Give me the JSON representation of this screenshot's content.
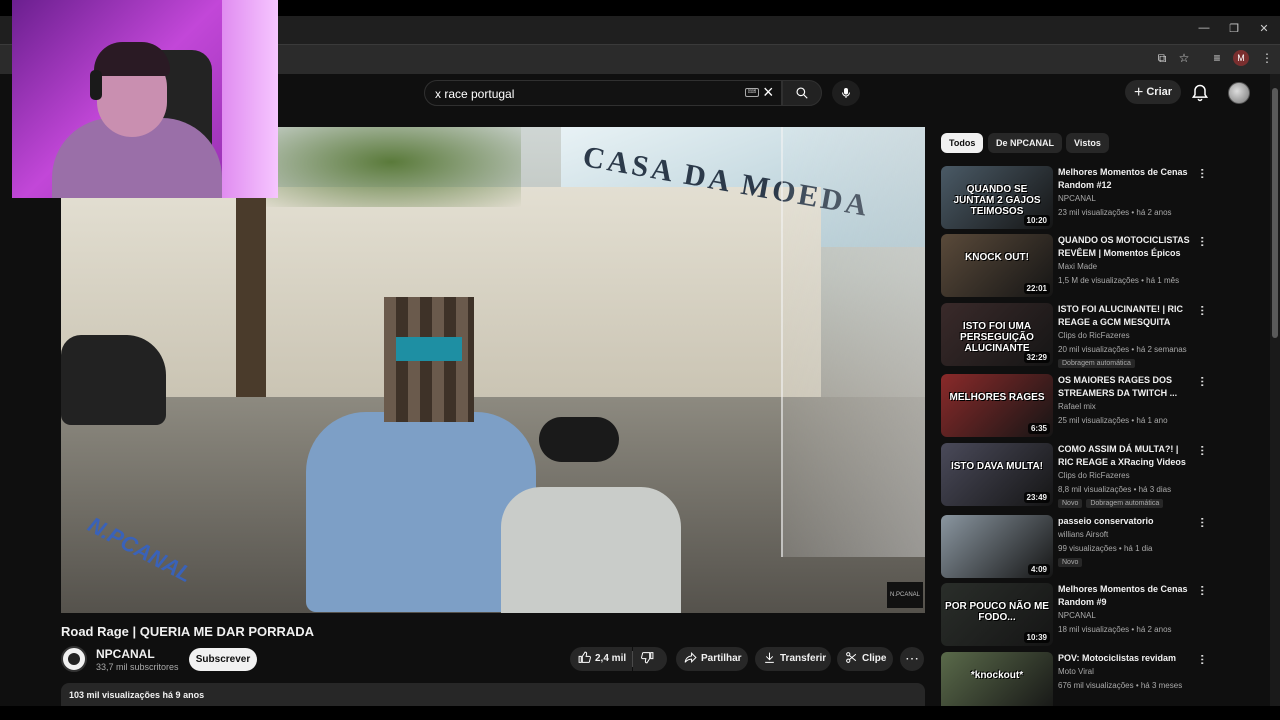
{
  "search": {
    "query": "x race portugal"
  },
  "header": {
    "create_label": "Criar"
  },
  "video": {
    "title": "Road Rage | QUERIA ME DAR PORRADA",
    "watermark": "N.PCANAL",
    "corner_logo": "N.PCANAL",
    "channel": {
      "name": "NPCANAL",
      "subscribers": "33,7 mil subscritores"
    },
    "subscribe_label": "Subscrever",
    "likes": "2,4 mil",
    "share_label": "Partilhar",
    "download_label": "Transferir",
    "clip_label": "Clipe",
    "stats": "103 mil visualizações  há 9 anos"
  },
  "chips": [
    "Todos",
    "De NPCANAL",
    "Vistos"
  ],
  "recommendations": [
    {
      "title": "Melhores Momentos de Cenas Random #12",
      "channel": "NPCANAL",
      "meta": "23 mil visualizações • há 2 anos",
      "duration": "10:20",
      "thumb_text": "QUANDO SE JUNTAM 2 GAJOS TEIMOSOS",
      "thumb_color": "#4a5a66",
      "badges": []
    },
    {
      "title": "QUANDO OS MOTOCICLISTAS REVÊEM | Momentos Épicos d...",
      "channel": "Maxi Made",
      "meta": "1,5 M de visualizações • há 1 mês",
      "duration": "22:01",
      "thumb_text": "KNOCK OUT!",
      "thumb_color": "#5a4a3a",
      "badges": []
    },
    {
      "title": "ISTO FOI ALUCINANTE! | RIC REAGE a GCM MESQUITA",
      "channel": "Clips do RicFazeres",
      "meta": "20 mil visualizações • há 2 semanas",
      "duration": "32:29",
      "thumb_text": "ISTO FOI UMA PERSEGUIÇÃO ALUCINANTE",
      "thumb_color": "#3a2a2a",
      "badges": [
        "Dobragem automática"
      ]
    },
    {
      "title": "OS MAIORES RAGES DOS STREAMERS DA TWITCH ...",
      "channel": "Rafael mix",
      "meta": "25 mil visualizações • há 1 ano",
      "duration": "6:35",
      "thumb_text": "MELHORES RAGES",
      "thumb_color": "#8a2a2a",
      "badges": []
    },
    {
      "title": "COMO ASSIM DÁ MULTA?! | RIC REAGE a XRacing Videos",
      "channel": "Clips do RicFazeres",
      "meta": "8,8 mil visualizações • há 3 dias",
      "duration": "23:49",
      "thumb_text": "ISTO DAVA MULTA!",
      "thumb_color": "#4a4a5a",
      "badges": [
        "Novo",
        "Dobragem automática"
      ]
    },
    {
      "title": "passeio conservatorio",
      "channel": "willians Airsoft",
      "meta": "99 visualizações • há 1 dia",
      "duration": "4:09",
      "thumb_text": "",
      "thumb_color": "#8a96a0",
      "badges": [
        "Novo"
      ]
    },
    {
      "title": "Melhores Momentos de Cenas Random #9",
      "channel": "NPCANAL",
      "meta": "18 mil visualizações • há 2 anos",
      "duration": "10:39",
      "thumb_text": "POR POUCO NÃO ME FODO...",
      "thumb_color": "#2a2e2a",
      "badges": []
    },
    {
      "title": "POV: Motociclistas revidam",
      "channel": "Moto Viral",
      "meta": "676 mil visualizações • há 3 meses",
      "duration": "",
      "thumb_text": "*knockout*",
      "thumb_color": "#5a6a4a",
      "badges": []
    }
  ]
}
